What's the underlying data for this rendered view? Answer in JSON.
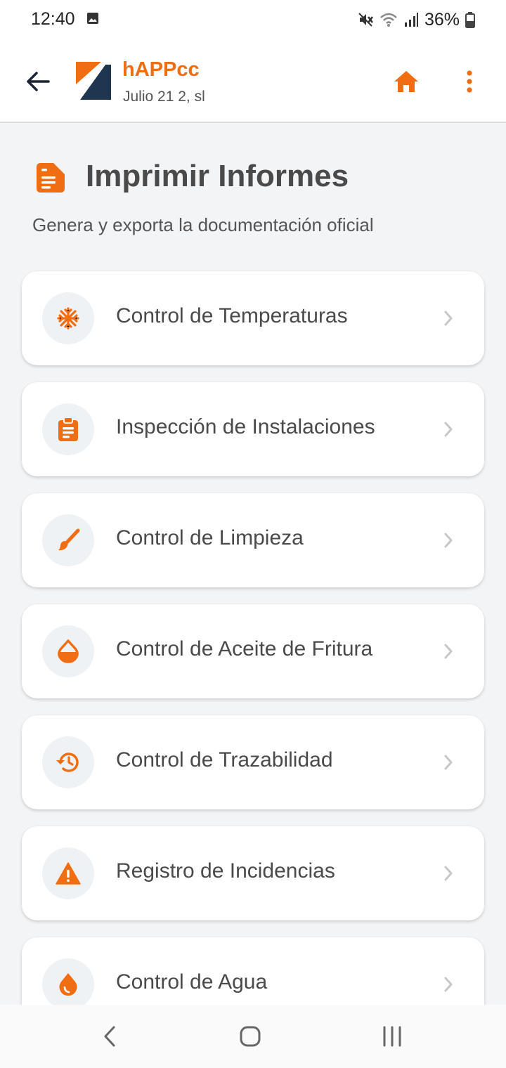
{
  "status_bar": {
    "time": "12:40",
    "battery_percent": "36%",
    "icons": [
      "image-icon",
      "mute-icon",
      "wifi-icon",
      "signal-icon",
      "battery-icon"
    ]
  },
  "app_bar": {
    "title": "hAPPcc",
    "subtitle": "Julio 21 2, sl",
    "accent_color": "#f06d12",
    "logo_colors": [
      "#f06d12",
      "#1e3650"
    ]
  },
  "page": {
    "title": "Imprimir Informes",
    "subtitle": "Genera y exporta la documentación oficial",
    "icon": "report-file-icon"
  },
  "report_items": [
    {
      "label": "Control de Temperaturas",
      "icon": "snowflake-icon"
    },
    {
      "label": "Inspección de Instalaciones",
      "icon": "clipboard-icon"
    },
    {
      "label": "Control de Limpieza",
      "icon": "brush-icon"
    },
    {
      "label": "Control de Aceite de Fritura",
      "icon": "oil-drop-icon"
    },
    {
      "label": "Control de Trazabilidad",
      "icon": "history-icon"
    },
    {
      "label": "Registro de Incidencias",
      "icon": "warning-icon"
    },
    {
      "label": "Control de Agua",
      "icon": "water-drop-icon"
    }
  ],
  "nav_bar": {
    "buttons": [
      "back-nav-icon",
      "home-nav-icon",
      "recents-nav-icon"
    ]
  }
}
